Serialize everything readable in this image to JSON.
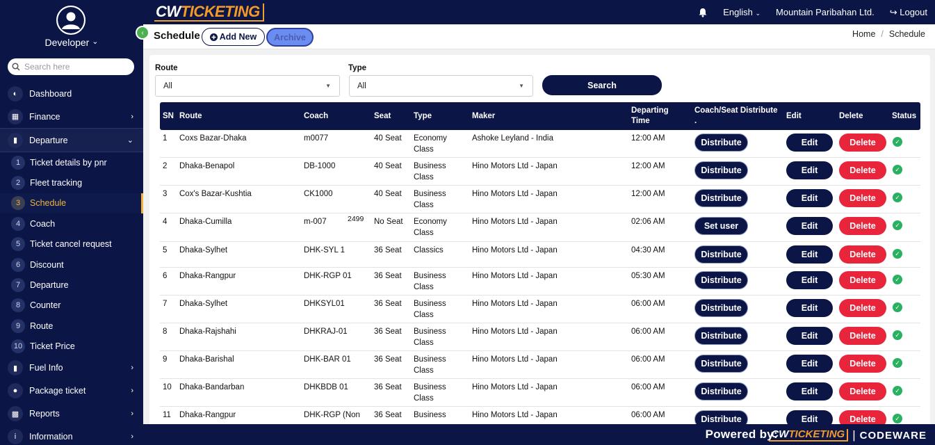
{
  "app": {
    "logo_cw": "CW",
    "logo_ticketing": "TICKETING"
  },
  "sidebar": {
    "user_name": "Developer",
    "user_chevron": "⌄",
    "search_placeholder": "Search here",
    "items_top": [
      {
        "label": "Dashboard",
        "icon": "dashboard-icon"
      },
      {
        "label": "Finance",
        "icon": "calculator-icon",
        "chev": "›"
      }
    ],
    "open_item": {
      "label": "Departure",
      "icon": "bus-icon",
      "chev": "⌄"
    },
    "sub_items": [
      {
        "num": "1",
        "label": "Ticket details by pnr"
      },
      {
        "num": "2",
        "label": "Fleet tracking"
      },
      {
        "num": "3",
        "label": "Schedule",
        "active": true
      },
      {
        "num": "4",
        "label": "Coach"
      },
      {
        "num": "5",
        "label": "Ticket cancel request"
      },
      {
        "num": "6",
        "label": "Discount"
      },
      {
        "num": "7",
        "label": "Departure"
      },
      {
        "num": "8",
        "label": "Counter"
      },
      {
        "num": "9",
        "label": "Route"
      },
      {
        "num": "10",
        "label": "Ticket Price"
      }
    ],
    "items_bottom": [
      {
        "label": "Fuel Info",
        "icon": "train-icon",
        "chev": "›"
      },
      {
        "label": "Package ticket",
        "icon": "user-icon",
        "chev": "›"
      },
      {
        "label": "Reports",
        "icon": "bar-chart-icon",
        "chev": "›"
      },
      {
        "label": "Information",
        "icon": "info-icon",
        "chev": "›"
      }
    ]
  },
  "topbar": {
    "language": "English",
    "company": "Mountain Paribahan Ltd.",
    "logout": "Logout"
  },
  "header": {
    "title": "Schedule",
    "add_new": "Add New",
    "archive": "Archive",
    "breadcrumb": [
      "Home",
      "Schedule"
    ]
  },
  "filters": {
    "route_label": "Route",
    "route_value": "All",
    "type_label": "Type",
    "type_value": "All",
    "search_button": "Search"
  },
  "table": {
    "headers": [
      "SN",
      "Route",
      "Coach",
      "Seat",
      "Type",
      "Maker",
      "Departing Time",
      "Coach/Seat Distribute .",
      "Edit",
      "Delete",
      "Status"
    ],
    "edit_label": "Edit",
    "delete_label": "Delete",
    "rows": [
      {
        "sn": "1",
        "route": "Coxs Bazar-Dhaka",
        "coach": "m0077",
        "note": "",
        "seat": "40 Seat",
        "type": "Economy Class",
        "maker": "Ashoke Leyland - India",
        "time": "12:00 AM",
        "action": "Distribute"
      },
      {
        "sn": "2",
        "route": "Dhaka-Benapol",
        "coach": "DB-1000",
        "note": "",
        "seat": "40 Seat",
        "type": "Business Class",
        "maker": "Hino Motors Ltd - Japan",
        "time": "12:00 AM",
        "action": "Distribute"
      },
      {
        "sn": "3",
        "route": "Cox's Bazar-Kushtia",
        "coach": "CK1000",
        "note": "",
        "seat": "40 Seat",
        "type": "Business Class",
        "maker": "Hino Motors Ltd - Japan",
        "time": "12:00 AM",
        "action": "Distribute"
      },
      {
        "sn": "4",
        "route": "Dhaka-Cumilla",
        "coach": "m-007",
        "note": "2499",
        "seat": "No Seat",
        "type": "Economy Class",
        "maker": "Hino Motors Ltd - Japan",
        "time": "02:06 AM",
        "action": "Set user"
      },
      {
        "sn": "5",
        "route": "Dhaka-Sylhet",
        "coach": "DHK-SYL 1",
        "note": "",
        "seat": "36 Seat",
        "type": "Classics",
        "maker": "Hino Motors Ltd - Japan",
        "time": "04:30 AM",
        "action": "Distribute"
      },
      {
        "sn": "6",
        "route": "Dhaka-Rangpur",
        "coach": "DHK-RGP 01",
        "note": "",
        "seat": "36 Seat",
        "type": "Business Class",
        "maker": "Hino Motors Ltd - Japan",
        "time": "05:30 AM",
        "action": "Distribute"
      },
      {
        "sn": "7",
        "route": "Dhaka-Sylhet",
        "coach": "DHKSYL01",
        "note": "",
        "seat": "36 Seat",
        "type": "Business Class",
        "maker": "Hino Motors Ltd - Japan",
        "time": "06:00 AM",
        "action": "Distribute"
      },
      {
        "sn": "8",
        "route": "Dhaka-Rajshahi",
        "coach": "DHKRAJ-01",
        "note": "",
        "seat": "36 Seat",
        "type": "Business Class",
        "maker": "Hino Motors Ltd - Japan",
        "time": "06:00 AM",
        "action": "Distribute"
      },
      {
        "sn": "9",
        "route": "Dhaka-Barishal",
        "coach": "DHK-BAR 01",
        "note": "",
        "seat": "36 Seat",
        "type": "Business Class",
        "maker": "Hino Motors Ltd - Japan",
        "time": "06:00 AM",
        "action": "Distribute"
      },
      {
        "sn": "10",
        "route": "Dhaka-Bandarban",
        "coach": "DHKBDB 01",
        "note": "",
        "seat": "36 Seat",
        "type": "Business Class",
        "maker": "Hino Motors Ltd - Japan",
        "time": "06:00 AM",
        "action": "Distribute"
      },
      {
        "sn": "11",
        "route": "Dhaka-Rangpur",
        "coach": "DHK-RGP (Non",
        "note": "",
        "seat": "36 Seat",
        "type": "Business",
        "maker": "Hino Motors Ltd - Japan",
        "time": "06:00 AM",
        "action": "Distribute"
      }
    ]
  },
  "footer": {
    "powered_by": "Powered by:",
    "logo_cw": "CW",
    "logo_ticketing": "TICKETING",
    "separator": "|",
    "codeware": "CODEWARE"
  }
}
